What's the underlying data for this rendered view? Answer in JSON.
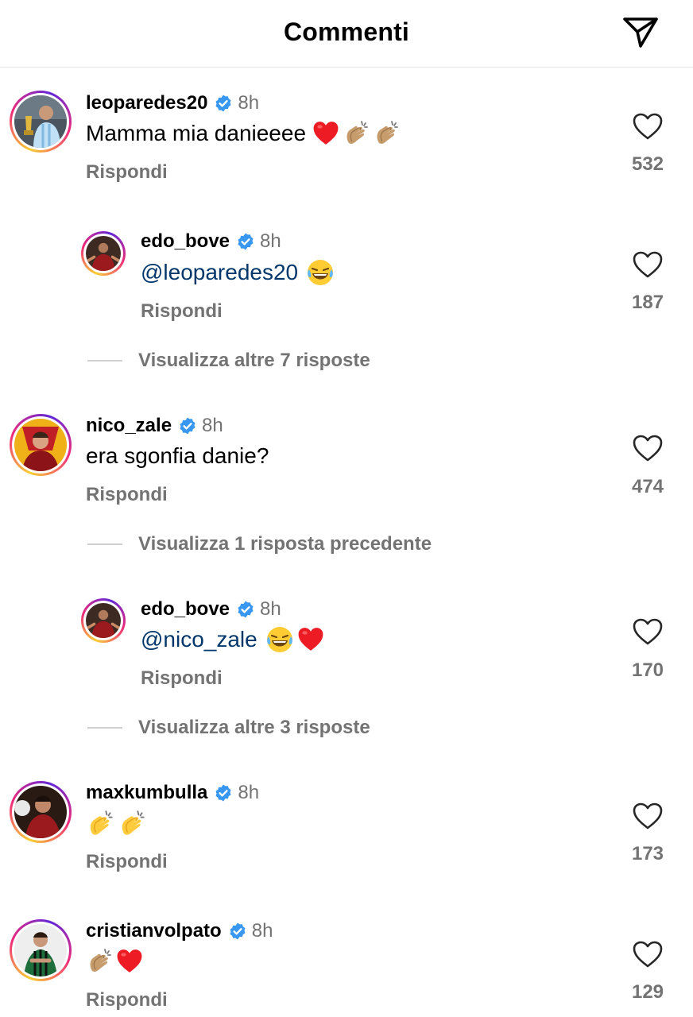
{
  "header": {
    "title": "Commenti",
    "icon": "send-icon"
  },
  "colors": {
    "mention": "#00376b",
    "muted": "#737373",
    "verified": "#3897f0",
    "heart": "#ed1c24"
  },
  "comments": [
    {
      "username": "leoparedes20",
      "time": "8h",
      "text": "Mamma mia danieeee",
      "emojis": [
        "heart",
        "clap",
        "clap"
      ],
      "reply_label": "Rispondi",
      "likes": "532"
    },
    {
      "username": "edo_bove",
      "time": "8h",
      "text": "@leoparedes20",
      "emojis": [
        "laugh"
      ],
      "reply_label": "Rispondi",
      "likes": "187"
    },
    {
      "username": "nico_zale",
      "time": "8h",
      "text": "era sgonfia danie?",
      "emojis": [],
      "reply_label": "Rispondi",
      "likes": "474"
    },
    {
      "username": "edo_bove",
      "time": "8h",
      "text": "@nico_zale",
      "emojis": [
        "laugh",
        "heart"
      ],
      "reply_label": "Rispondi",
      "likes": "170"
    },
    {
      "username": "maxkumbulla",
      "time": "8h",
      "text": "",
      "emojis": [
        "clap-yellow",
        "clap-yellow"
      ],
      "reply_label": "Rispondi",
      "likes": "173"
    },
    {
      "username": "cristianvolpato",
      "time": "8h",
      "text": "",
      "emojis": [
        "clap",
        "heart"
      ],
      "reply_label": "Rispondi",
      "likes": "129"
    }
  ],
  "view_more": [
    "Visualizza altre 7 risposte",
    "Visualizza 1 risposta precedente",
    "Visualizza altre 3 risposte"
  ]
}
